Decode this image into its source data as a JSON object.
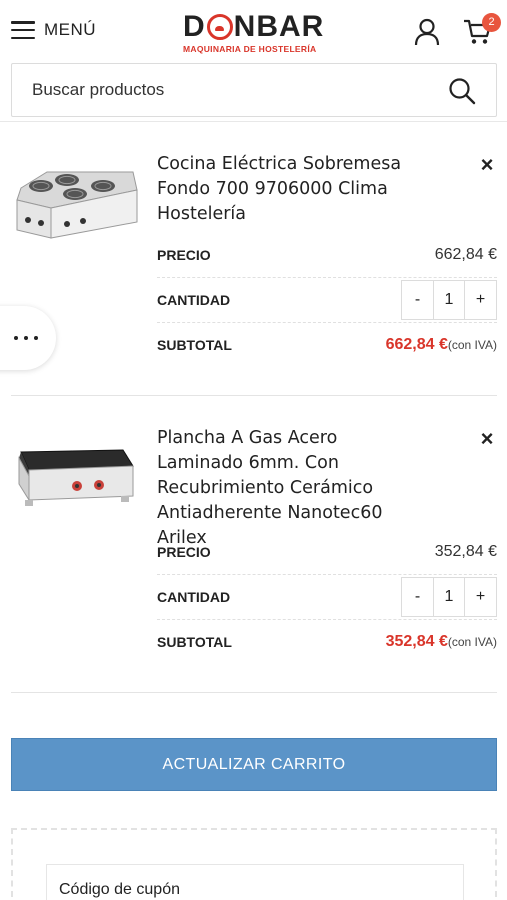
{
  "header": {
    "menu_label": "MENÚ",
    "logo_left": "D",
    "logo_right": "N",
    "logo_bar": "BAR",
    "logo_sub": "MAQUINARIA DE HOSTELERÍA",
    "cart_count": "2"
  },
  "search": {
    "placeholder": "Buscar productos"
  },
  "labels": {
    "price": "PRECIO",
    "quantity": "CANTIDAD",
    "subtotal": "SUBTOTAL",
    "minus": "-",
    "plus": "+",
    "remove": "×",
    "tax_note": "(con IVA)"
  },
  "items": [
    {
      "title": "Cocina Eléctrica Sobremesa Fondo 700 9706000 Clima Hostelería",
      "price": "662,84 €",
      "quantity": "1",
      "subtotal": "662,84 €"
    },
    {
      "title": "Plancha A Gas Acero Laminado 6mm. Con Recubrimiento Cerámico Antiadherente Nanotec60 Arilex",
      "price": "352,84 €",
      "quantity": "1",
      "subtotal": "352,84 €"
    }
  ],
  "cart": {
    "update_label": "ACTUALIZAR CARRITO",
    "coupon_placeholder": "Código de cupón"
  },
  "colors": {
    "accent_red": "#d9352a",
    "button_blue": "#5b94c8",
    "badge": "#e8553e"
  }
}
